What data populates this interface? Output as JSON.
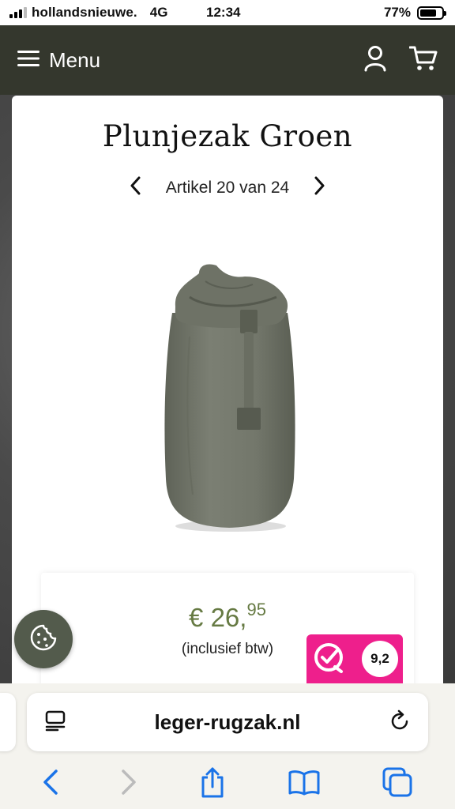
{
  "status_bar": {
    "carrier": "hollandsnieuwe.",
    "network": "4G",
    "time": "12:34",
    "battery": "77%",
    "battery_level": 0.77
  },
  "header": {
    "menu_label": "Menu",
    "icons": [
      "menu-icon",
      "account-icon",
      "cart-icon"
    ],
    "background": "#34372d"
  },
  "product": {
    "title": "Plunjezak Groen",
    "pager_text": "Artikel 20 van 24",
    "price_main": "€ 26,",
    "price_cents": "95",
    "vat_note": "(inclusief btw)",
    "price_color": "#667a43"
  },
  "rating": {
    "score": "9,2",
    "color": "#ee1f8c"
  },
  "browser": {
    "url": "leger-rugzak.nl",
    "toolbar_icons": [
      "back-icon",
      "forward-icon",
      "share-icon",
      "bookmarks-icon",
      "tabs-icon"
    ]
  }
}
